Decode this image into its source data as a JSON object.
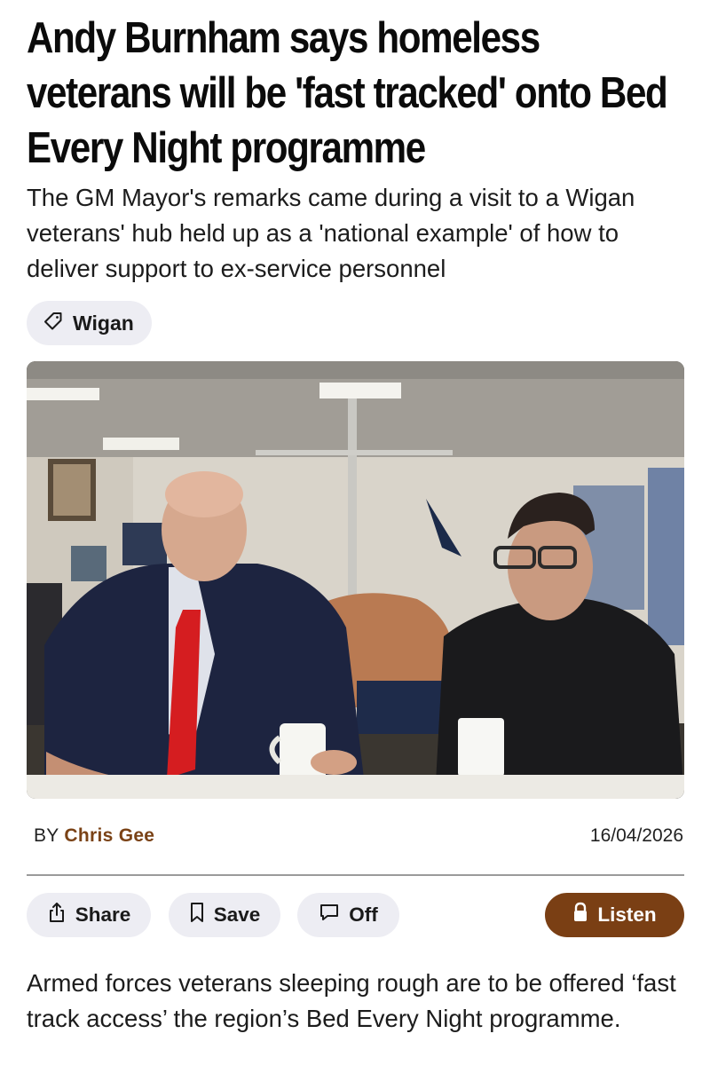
{
  "article": {
    "headline": "Andy Burnham says homeless veterans will be 'fast tracked' onto Bed Every Night programme",
    "standfirst": "The GM Mayor's remarks came during a visit to a Wigan veterans' hub held up as a 'national example' of how to deliver support to ex-service personnel",
    "tag": {
      "label": "Wigan",
      "icon": "tag-icon"
    },
    "hero_image": {
      "icon": "photo"
    },
    "byline": {
      "prefix": "BY",
      "author": "Chris Gee",
      "author_color": "#7a4216"
    },
    "date": "16/04/2026",
    "body_first_paragraph": "Armed forces veterans sleeping rough are to be offered ‘fast track access’ the region’s Bed Every Night programme."
  },
  "actions": {
    "share": {
      "label": "Share",
      "icon": "share-icon"
    },
    "save": {
      "label": "Save",
      "icon": "bookmark-icon"
    },
    "comments": {
      "label": "Off",
      "icon": "comment-icon"
    },
    "listen": {
      "label": "Listen",
      "icon": "lock-icon",
      "color": "#7a3f14"
    }
  },
  "colors": {
    "pill_background": "#ededf3",
    "accent_brown": "#7a3f14",
    "text": "#111111"
  }
}
